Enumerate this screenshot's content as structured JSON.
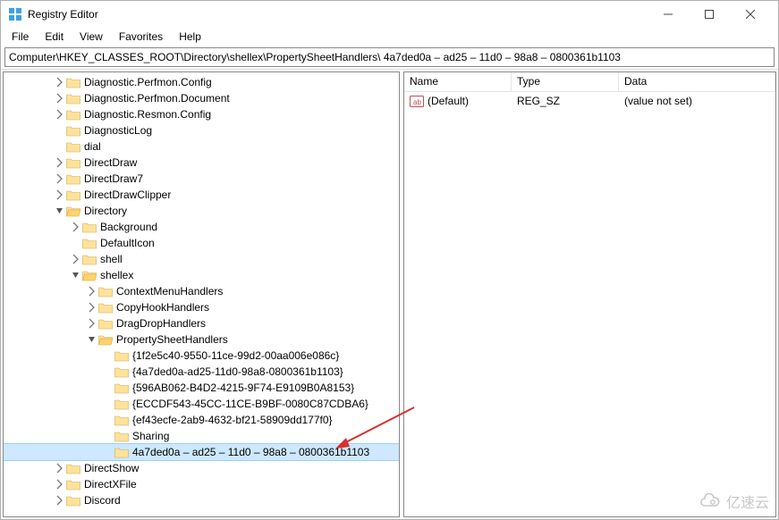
{
  "window": {
    "title": "Registry Editor"
  },
  "menu": {
    "file": "File",
    "edit": "Edit",
    "view": "View",
    "favorites": "Favorites",
    "help": "Help"
  },
  "address": "Computer\\HKEY_CLASSES_ROOT\\Directory\\shellex\\PropertySheetHandlers\\ 4a7ded0a – ad25 – 11d0 – 98a8 – 0800361b1103",
  "tree": [
    {
      "depth": 2,
      "label": "Diagnostic.Perfmon.Config",
      "chev": "closed"
    },
    {
      "depth": 2,
      "label": "Diagnostic.Perfmon.Document",
      "chev": "closed"
    },
    {
      "depth": 2,
      "label": "Diagnostic.Resmon.Config",
      "chev": "closed"
    },
    {
      "depth": 2,
      "label": "DiagnosticLog",
      "chev": "none"
    },
    {
      "depth": 2,
      "label": "dial",
      "chev": "none"
    },
    {
      "depth": 2,
      "label": "DirectDraw",
      "chev": "closed"
    },
    {
      "depth": 2,
      "label": "DirectDraw7",
      "chev": "closed"
    },
    {
      "depth": 2,
      "label": "DirectDrawClipper",
      "chev": "closed"
    },
    {
      "depth": 2,
      "label": "Directory",
      "chev": "open"
    },
    {
      "depth": 3,
      "label": "Background",
      "chev": "closed"
    },
    {
      "depth": 3,
      "label": "DefaultIcon",
      "chev": "none"
    },
    {
      "depth": 3,
      "label": "shell",
      "chev": "closed"
    },
    {
      "depth": 3,
      "label": "shellex",
      "chev": "open"
    },
    {
      "depth": 4,
      "label": "ContextMenuHandlers",
      "chev": "closed"
    },
    {
      "depth": 4,
      "label": "CopyHookHandlers",
      "chev": "closed"
    },
    {
      "depth": 4,
      "label": "DragDropHandlers",
      "chev": "closed"
    },
    {
      "depth": 4,
      "label": "PropertySheetHandlers",
      "chev": "open"
    },
    {
      "depth": 5,
      "label": "{1f2e5c40-9550-11ce-99d2-00aa006e086c}",
      "chev": "none"
    },
    {
      "depth": 5,
      "label": "{4a7ded0a-ad25-11d0-98a8-0800361b1103}",
      "chev": "none"
    },
    {
      "depth": 5,
      "label": "{596AB062-B4D2-4215-9F74-E9109B0A8153}",
      "chev": "none"
    },
    {
      "depth": 5,
      "label": "{ECCDF543-45CC-11CE-B9BF-0080C87CDBA6}",
      "chev": "none"
    },
    {
      "depth": 5,
      "label": "{ef43ecfe-2ab9-4632-bf21-58909dd177f0}",
      "chev": "none"
    },
    {
      "depth": 5,
      "label": "Sharing",
      "chev": "none"
    },
    {
      "depth": 5,
      "label": " 4a7ded0a – ad25 – 11d0 – 98a8 – 0800361b1103",
      "chev": "none",
      "selected": true
    },
    {
      "depth": 2,
      "label": "DirectShow",
      "chev": "closed"
    },
    {
      "depth": 2,
      "label": "DirectXFile",
      "chev": "closed"
    },
    {
      "depth": 2,
      "label": "Discord",
      "chev": "closed"
    }
  ],
  "list": {
    "headers": {
      "name": "Name",
      "type": "Type",
      "data": "Data"
    },
    "name_width": 120,
    "type_width": 120,
    "rows": [
      {
        "name": "(Default)",
        "type": "REG_SZ",
        "data": "(value not set)",
        "icon": "string"
      }
    ]
  },
  "watermark": "亿速云"
}
